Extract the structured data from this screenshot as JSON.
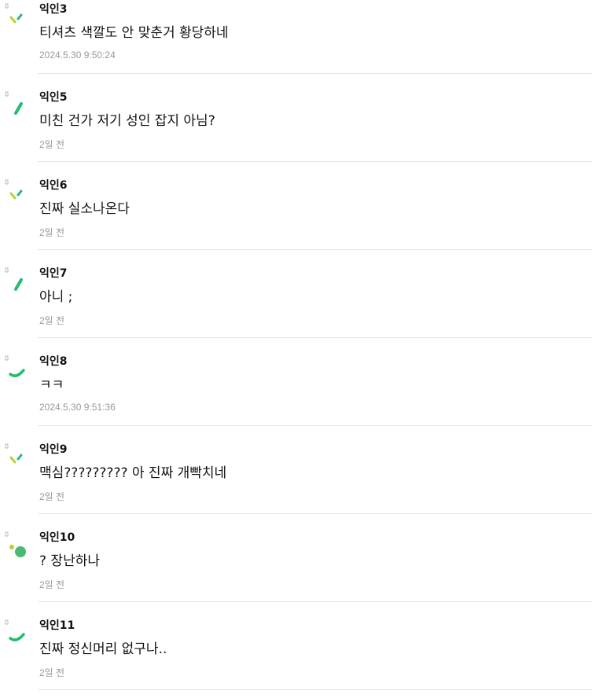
{
  "comments": [
    {
      "nick": "익인3",
      "text": "티셔츠 색깔도 안 맞춘거 황당하네",
      "date": "2024.5.30 9:50:24",
      "avatar": "avatar-dashes-icon"
    },
    {
      "nick": "익인5",
      "text": "미친 건가 저기 성인 잡지 아님?",
      "date": "2일 전",
      "avatar": "avatar-slash-icon"
    },
    {
      "nick": "익인6",
      "text": "진짜 실소나온다",
      "date": "2일 전",
      "avatar": "avatar-dashes-icon"
    },
    {
      "nick": "익인7",
      "text": "아니 ;",
      "date": "2일 전",
      "avatar": "avatar-slash-icon"
    },
    {
      "nick": "익인8",
      "text": "ㅋㅋ",
      "date": "2024.5.30 9:51:36",
      "avatar": "avatar-arc-icon"
    },
    {
      "nick": "익인9",
      "text": "맥심????????? 아 진짜 개빡치네",
      "date": "2일 전",
      "avatar": "avatar-dashes-icon"
    },
    {
      "nick": "익인10",
      "text": "? 장난하나",
      "date": "2일 전",
      "avatar": "avatar-dots-icon"
    },
    {
      "nick": "익인11",
      "text": "진짜 정신머리 없구나..",
      "date": "2일 전",
      "avatar": "avatar-arc-icon"
    }
  ],
  "colors": {
    "lime": "#b5d334",
    "green": "#1fbf6b",
    "teal": "#25b87a",
    "dot": "#4bb974"
  }
}
